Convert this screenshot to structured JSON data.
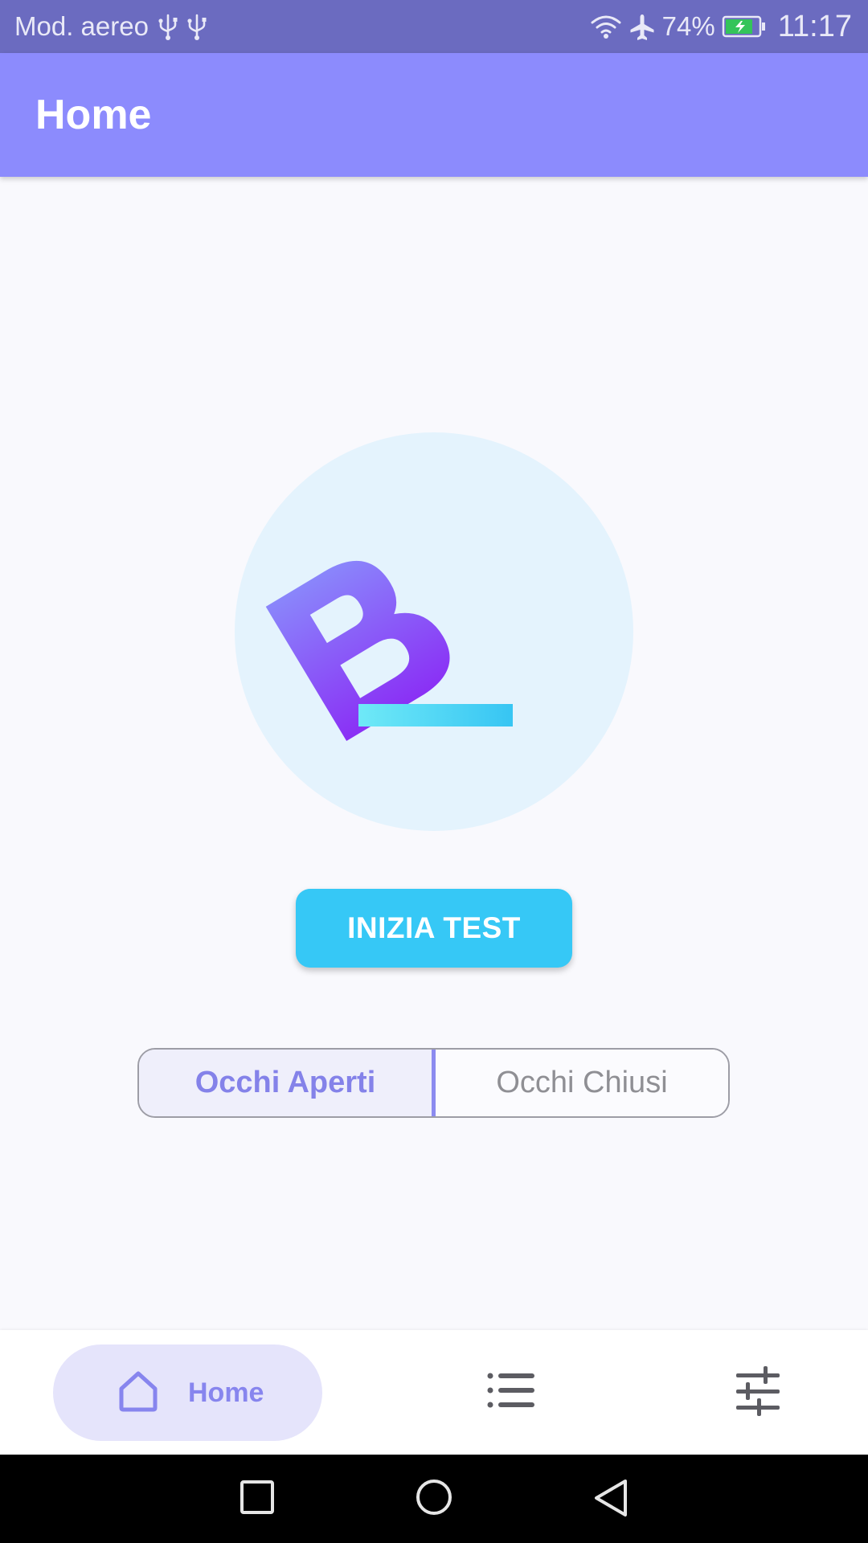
{
  "status_bar": {
    "mode_text": "Mod. aereo",
    "battery": "74%",
    "time": "11:17",
    "icons": [
      "usb-icon",
      "usb-icon",
      "wifi-icon",
      "airplane-icon",
      "battery-charging-icon"
    ]
  },
  "app_bar": {
    "title": "Home"
  },
  "main": {
    "logo_icon": "logo-b-icon",
    "start_button": "INIZIA TEST",
    "segments": [
      {
        "label": "Occhi Aperti",
        "selected": true
      },
      {
        "label": "Occhi Chiusi",
        "selected": false
      }
    ]
  },
  "bottom_nav": {
    "items": [
      {
        "label": "Home",
        "icon": "home-icon",
        "selected": true
      },
      {
        "label": "",
        "icon": "list-icon",
        "selected": false
      },
      {
        "label": "",
        "icon": "sliders-icon",
        "selected": false
      }
    ]
  },
  "system_nav": {
    "icons": [
      "recents-icon",
      "home-circle-icon",
      "back-icon"
    ]
  },
  "colors": {
    "status_bar": "#6b6bc0",
    "app_bar": "#8c8bfd",
    "accent_button": "#36c8f6",
    "logo_circle": "#e4f3fd",
    "selected_purple": "#8785ee",
    "nav_pill": "#e5e4fb"
  }
}
